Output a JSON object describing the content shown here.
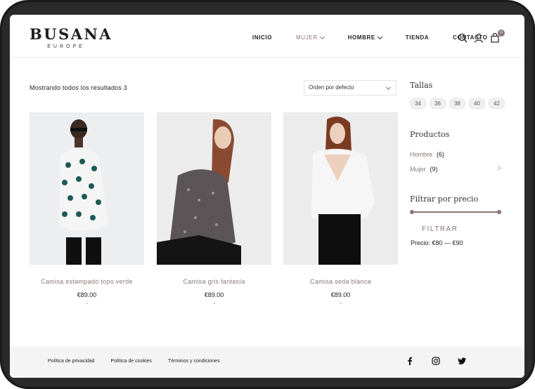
{
  "brand": {
    "name": "BUSANA",
    "sub": "EUROPE"
  },
  "nav": [
    {
      "label": "INICIO",
      "has_dropdown": false,
      "active": false
    },
    {
      "label": "MUJER",
      "has_dropdown": true,
      "active": true
    },
    {
      "label": "HOMBRE",
      "has_dropdown": true,
      "active": false
    },
    {
      "label": "TIENDA",
      "has_dropdown": false,
      "active": false
    },
    {
      "label": "CONTACTO",
      "has_dropdown": false,
      "active": false
    }
  ],
  "header_icons": [
    "search-icon",
    "user-icon",
    "cart-icon"
  ],
  "cart_count": "0",
  "result_count": "Mostrando todos los resultados 3",
  "sort": {
    "selected": "Orden por defecto"
  },
  "products": [
    {
      "name": "Camisa estampado topo verde",
      "price": "€89.00"
    },
    {
      "name": "Camisa gris fantasía",
      "price": "€89.00"
    },
    {
      "name": "Camisa seda blanca",
      "price": "€89.00"
    }
  ],
  "sidebar": {
    "sizes_title": "Tallas",
    "sizes": [
      "34",
      "36",
      "38",
      "40",
      "42"
    ],
    "products_title": "Productos",
    "categories": [
      {
        "label": "Hombre",
        "count": "(6)"
      },
      {
        "label": "Mujer",
        "count": "(9)"
      }
    ],
    "price_title": "Filtrar por precio",
    "filter_label": "FILTRAR",
    "price_range": "Precio: €80 — €90"
  },
  "footer": {
    "links": [
      "Política de privacidad",
      "Política de cookies",
      "Términos y condiciones"
    ],
    "social": [
      "facebook-icon",
      "instagram-icon",
      "twitter-icon"
    ]
  },
  "colors": {
    "accent": "#8a7677",
    "footer_bg": "#f4f4f5",
    "text": "#222222"
  }
}
